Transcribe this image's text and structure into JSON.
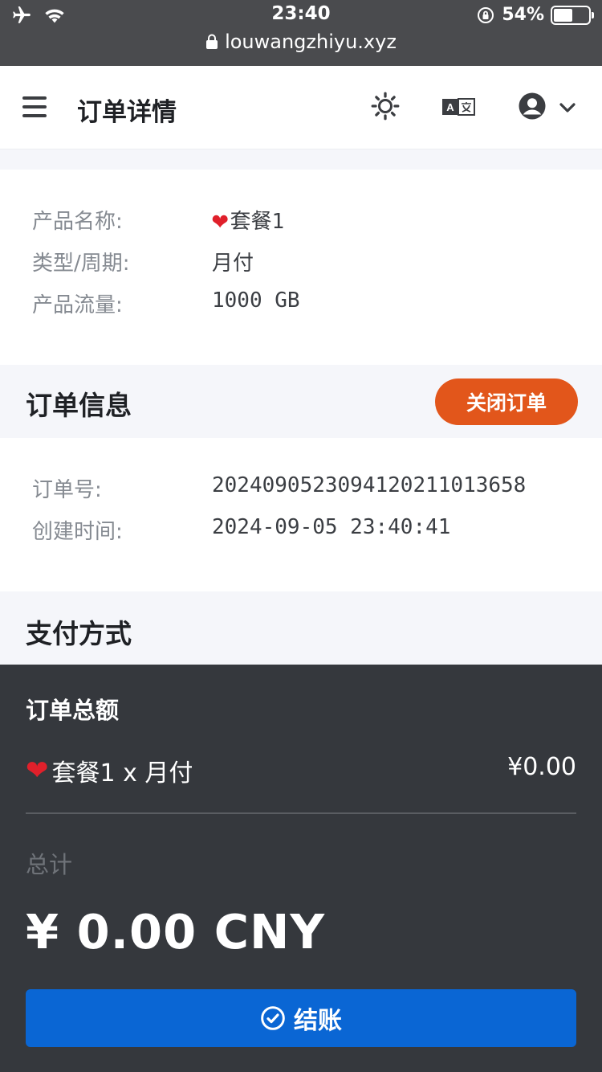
{
  "status_bar": {
    "time": "23:40",
    "battery_text": "54%",
    "battery_level": 0.54,
    "url": "louwangzhiyu.xyz"
  },
  "header": {
    "title": "订单详情",
    "icons": [
      "menu-icon",
      "sun-icon",
      "translate-icon",
      "account-icon",
      "chevron-down-icon"
    ]
  },
  "product": {
    "rows": [
      {
        "label": "产品名称:",
        "value": "套餐1",
        "has_heart": true
      },
      {
        "label": "类型/周期:",
        "value": "月付"
      },
      {
        "label": "产品流量:",
        "value": "1000 GB"
      }
    ]
  },
  "order_info": {
    "title": "订单信息",
    "close_button": "关闭订单",
    "rows": [
      {
        "label": "订单号:",
        "value": "2024090523094120211013658"
      },
      {
        "label": "创建时间:",
        "value": "2024-09-05 23:40:41"
      }
    ]
  },
  "payment": {
    "title": "支付方式"
  },
  "summary": {
    "title": "订单总额",
    "item_label": "套餐1 x 月付",
    "item_price": "¥0.00",
    "total_label": "总计",
    "total_value": "¥ 0.00 CNY",
    "checkout_label": "结账"
  },
  "colors": {
    "accent": "#e2561b",
    "primary": "#0a66d4",
    "summary_bg": "#35383d"
  }
}
